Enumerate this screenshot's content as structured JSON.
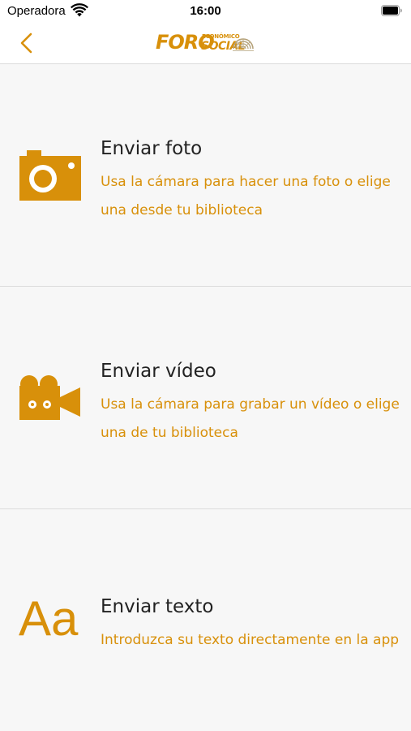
{
  "status_bar": {
    "carrier": "Operadora",
    "time": "16:00"
  },
  "nav": {
    "logo_main": "FORO",
    "logo_sub_top": "ECONÓMICO",
    "logo_sub_bottom": "SOCIAL"
  },
  "options": [
    {
      "title": "Enviar foto",
      "description": "Usa la cámara para hacer una foto o elige una desde tu biblioteca",
      "icon": "camera-icon"
    },
    {
      "title": "Enviar vídeo",
      "description": "Usa la cámara para grabar un vídeo o elige una de tu biblioteca",
      "icon": "video-camera-icon"
    },
    {
      "title": "Enviar texto",
      "description": "Introduzca su texto directamente en la app",
      "icon": "text-icon",
      "icon_glyph": "Aa"
    }
  ],
  "colors": {
    "accent": "#d8900a",
    "background": "#f7f7f7",
    "title_text": "#222222"
  }
}
